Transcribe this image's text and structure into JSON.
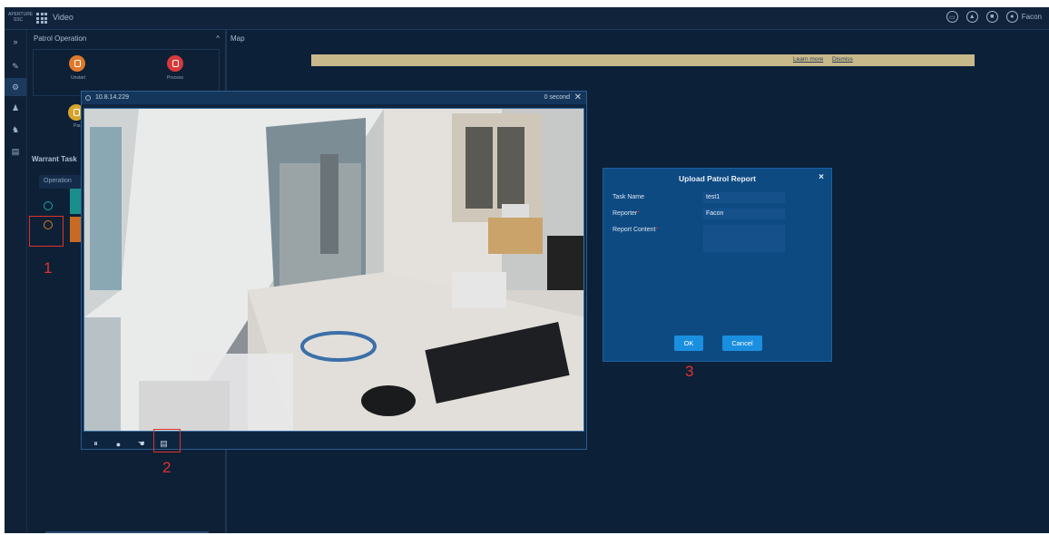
{
  "topbar": {
    "logo_text": "APERTURE SSC",
    "app_title": "Video",
    "user_name": "Facon",
    "icons": [
      "display-icon",
      "bell-icon",
      "alarm-icon",
      "user-icon"
    ]
  },
  "rail": {
    "icons": [
      "collapse-icon",
      "patrol-icon",
      "patrol-active-icon",
      "person-icon",
      "group-icon",
      "report-icon"
    ]
  },
  "panel": {
    "title": "Patrol Operation",
    "operations": [
      {
        "label": "Unstart",
        "color": "#e0782a"
      },
      {
        "label": "Process",
        "color": "#d83a3a"
      },
      {
        "label": "Pau",
        "color": "#d7a42b"
      }
    ],
    "warrant_title": "Warrant Task",
    "operation_column": "Operation"
  },
  "map": {
    "label": "Map",
    "notice_link1": "Learn more",
    "notice_link2": "Dismiss"
  },
  "video": {
    "ip": "10.8.14.229",
    "elapsed": "0 second",
    "tools": [
      "pause-icon",
      "location-icon",
      "hand-icon",
      "report-icon"
    ]
  },
  "annotations": [
    "1",
    "2",
    "3"
  ],
  "dialog": {
    "title": "Upload Patrol Report",
    "task_name_label": "Task Name",
    "task_name_value": "test1",
    "reporter_label": "Reporter",
    "reporter_required": "*",
    "reporter_value": "Facon",
    "content_label": "Report Content",
    "content_required": "*",
    "ok_label": "OK",
    "cancel_label": "Cancel"
  },
  "colors": {
    "background": "#0c2038",
    "dialog": "#0e4a82",
    "button": "#1a8fe0",
    "annotation": "#e0322a",
    "notice": "#c8b98a"
  }
}
